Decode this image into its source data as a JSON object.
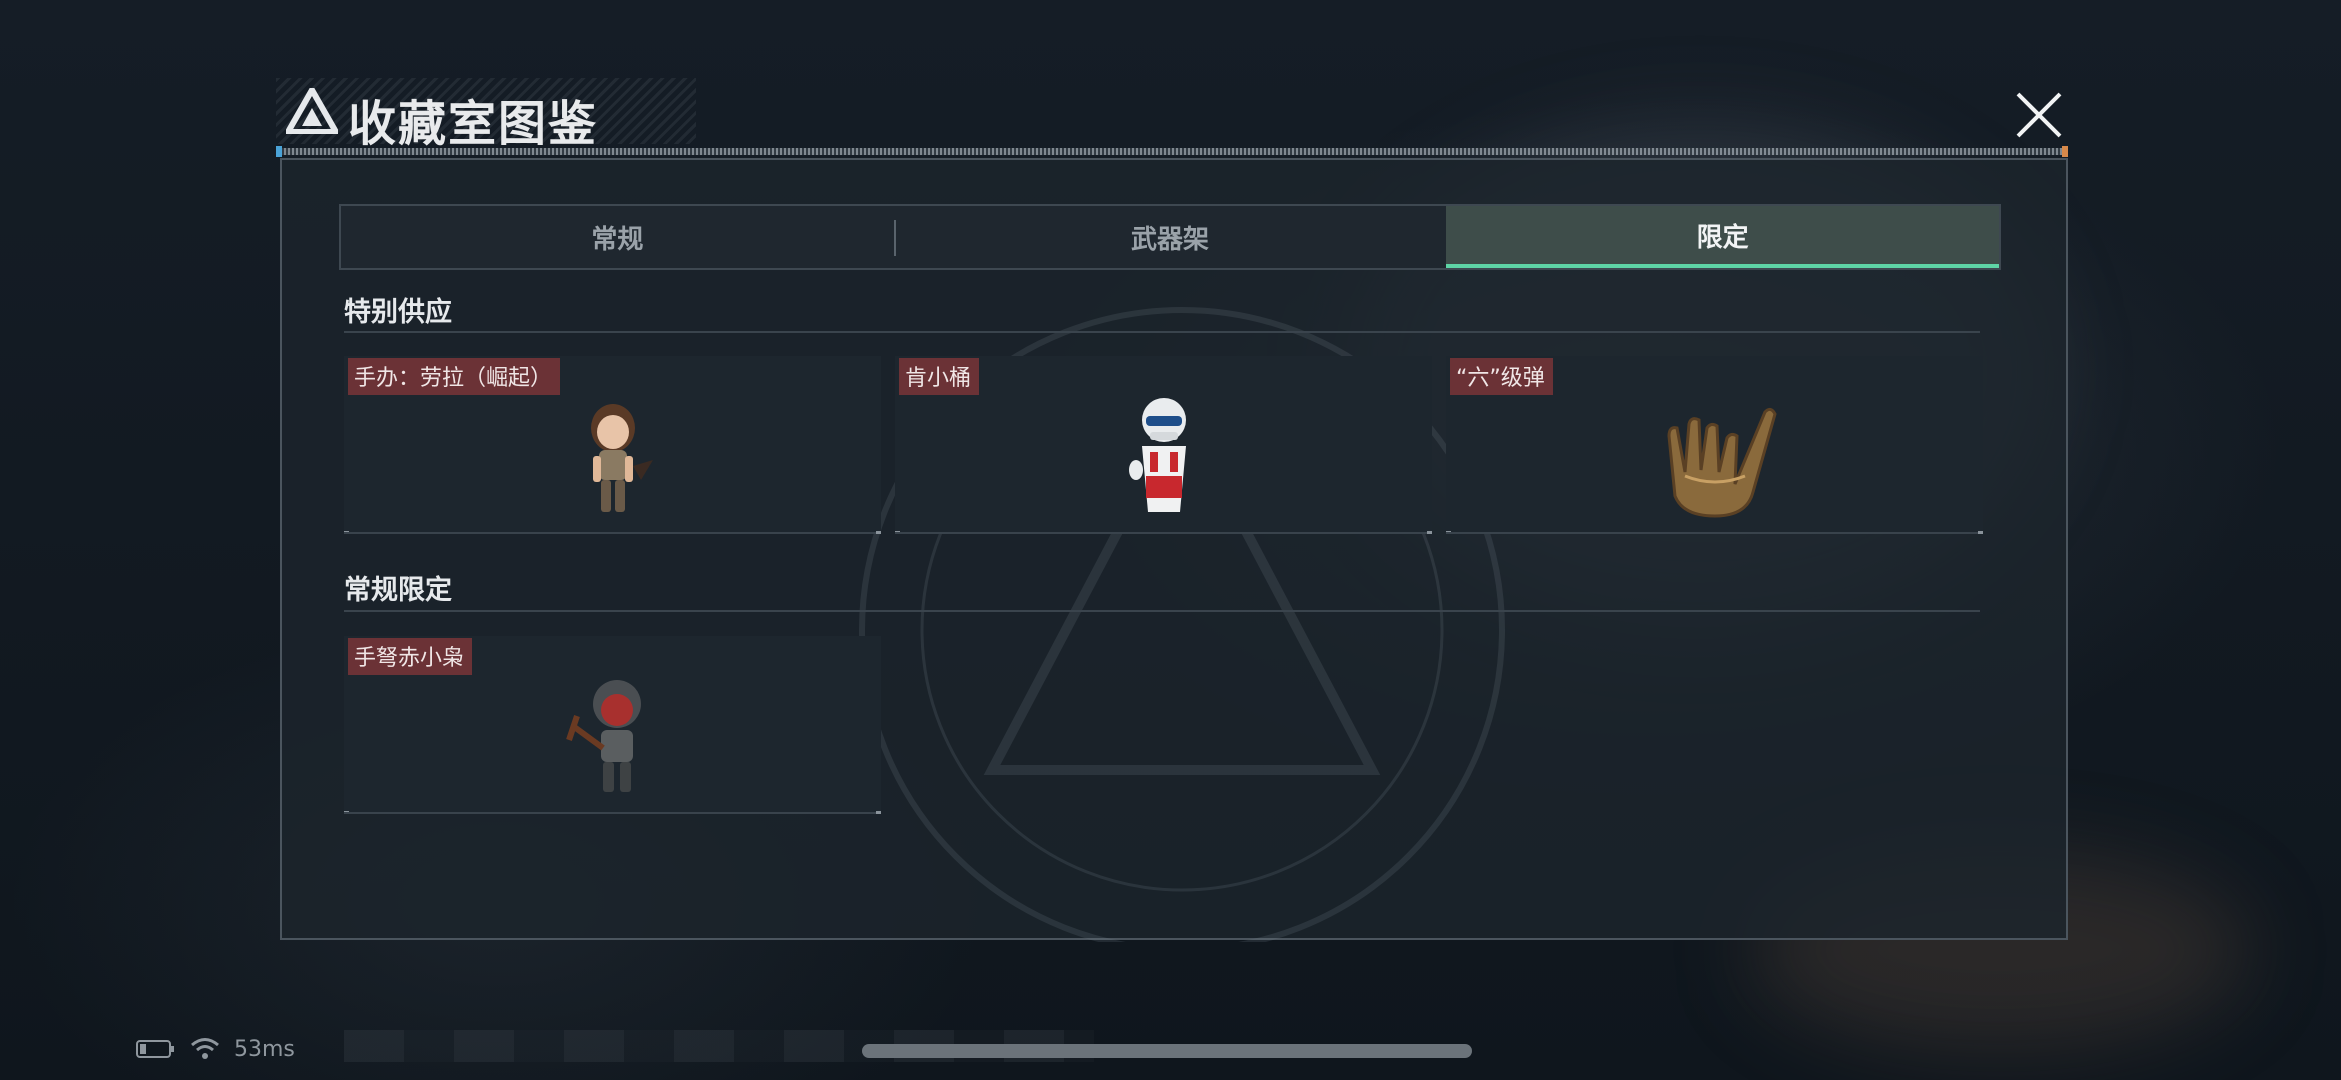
{
  "header": {
    "title": "收藏室图鉴"
  },
  "tabs": [
    {
      "label": "常规",
      "active": false
    },
    {
      "label": "武器架",
      "active": false
    },
    {
      "label": "限定",
      "active": true
    }
  ],
  "sections": [
    {
      "title": "特别供应",
      "items": [
        {
          "label": "手办：劳拉（崛起）",
          "icon": "lara-figure-icon"
        },
        {
          "label": "肯小桶",
          "icon": "kfc-bucket-figure-icon"
        },
        {
          "label": "“六”级弹",
          "icon": "golden-hand-sign-icon"
        }
      ]
    },
    {
      "title": "常规限定",
      "items": [
        {
          "label": "手弩赤小枭",
          "icon": "crossbow-red-figure-icon"
        }
      ]
    }
  ],
  "status_bar": {
    "battery_icon": "battery-icon",
    "wifi_icon": "wifi-icon",
    "latency": "53ms"
  },
  "colors": {
    "accent": "#5ed4a6",
    "label_bg": "#6b3236",
    "panel_bg": "#1c242c"
  }
}
